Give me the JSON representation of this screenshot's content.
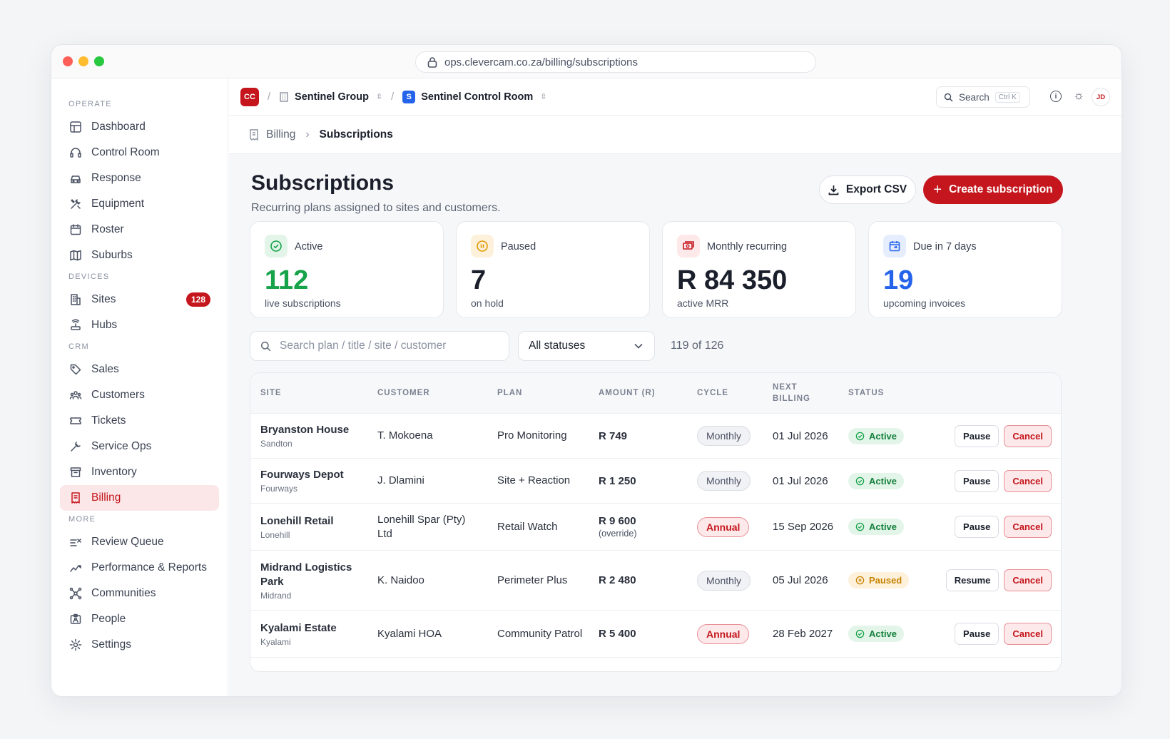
{
  "browser": {
    "url": "ops.clevercam.co.za/billing/subscriptions"
  },
  "sidebar": {
    "sections": [
      {
        "title": "OPERATE",
        "items": [
          {
            "label": "Dashboard",
            "icon": "layout-icon"
          },
          {
            "label": "Control Room",
            "icon": "headset-icon"
          },
          {
            "label": "Response",
            "icon": "car-icon"
          },
          {
            "label": "Equipment",
            "icon": "tools-icon"
          },
          {
            "label": "Roster",
            "icon": "calendar-icon"
          },
          {
            "label": "Suburbs",
            "icon": "map-icon"
          }
        ]
      },
      {
        "title": "DEVICES",
        "items": [
          {
            "label": "Sites",
            "icon": "building-icon",
            "badge": "128"
          },
          {
            "label": "Hubs",
            "icon": "router-icon"
          }
        ]
      },
      {
        "title": "CRM",
        "items": [
          {
            "label": "Sales",
            "icon": "tag-icon"
          },
          {
            "label": "Customers",
            "icon": "users-icon"
          },
          {
            "label": "Tickets",
            "icon": "ticket-icon"
          },
          {
            "label": "Service Ops",
            "icon": "wrench-icon"
          },
          {
            "label": "Inventory",
            "icon": "archive-icon"
          },
          {
            "label": "Billing",
            "icon": "receipt-icon",
            "active": true
          }
        ]
      },
      {
        "title": "MORE",
        "items": [
          {
            "label": "Review Queue",
            "icon": "review-icon"
          },
          {
            "label": "Performance & Reports",
            "icon": "chart-icon"
          },
          {
            "label": "Communities",
            "icon": "network-icon"
          },
          {
            "label": "People",
            "icon": "id-card-icon"
          },
          {
            "label": "Settings",
            "icon": "gear-icon"
          }
        ]
      }
    ]
  },
  "topbar": {
    "org_initials": "CC",
    "org": "Sentinel Group",
    "workspace_initial": "S",
    "workspace": "Sentinel Control Room",
    "search_label": "Search",
    "search_shortcut": "Ctrl K",
    "avatar": "JD"
  },
  "breadcrumb": {
    "parent": "Billing",
    "current": "Subscriptions"
  },
  "page": {
    "title": "Subscriptions",
    "subtitle": "Recurring plans assigned to sites and customers.",
    "export_label": "Export CSV",
    "create_label": "Create subscription"
  },
  "stats": [
    {
      "label": "Active",
      "value": "112",
      "sub": "live subscriptions",
      "color": "#16a34a",
      "icon": "check-circle-icon"
    },
    {
      "label": "Paused",
      "value": "7",
      "sub": "on hold",
      "color": "#1a1f2b",
      "icon": "pause-circle-icon"
    },
    {
      "label": "Monthly recurring",
      "value": "R 84 350",
      "sub": "active MRR",
      "color": "#1a1f2b",
      "icon": "money-icon"
    },
    {
      "label": "Due in 7 days",
      "value": "19",
      "sub": "upcoming invoices",
      "color": "#2563eb",
      "icon": "calendar-due-icon"
    }
  ],
  "filters": {
    "search_placeholder": "Search plan / title / site / customer",
    "status_value": "All statuses",
    "count": "119 of 126"
  },
  "table": {
    "columns": [
      "SITE",
      "CUSTOMER",
      "PLAN",
      "AMOUNT (R)",
      "CYCLE",
      "NEXT BILLING",
      "STATUS"
    ],
    "rows": [
      {
        "site": "Bryanston House",
        "suburb": "Sandton",
        "customer": "T. Mokoena",
        "plan": "Pro Monitoring",
        "amount": "R 749",
        "amount_note": "",
        "cycle": "Monthly",
        "next": "01 Jul 2026",
        "status": "Active",
        "action": "Pause",
        "cancel": "Cancel"
      },
      {
        "site": "Fourways Depot",
        "suburb": "Fourways",
        "customer": "J. Dlamini",
        "plan": "Site + Reaction",
        "amount": "R 1 250",
        "amount_note": "",
        "cycle": "Monthly",
        "next": "01 Jul 2026",
        "status": "Active",
        "action": "Pause",
        "cancel": "Cancel"
      },
      {
        "site": "Lonehill Retail",
        "suburb": "Lonehill",
        "customer": "Lonehill Spar (Pty) Ltd",
        "plan": "Retail Watch",
        "amount": "R 9 600",
        "amount_note": "(override)",
        "cycle": "Annual",
        "next": "15 Sep 2026",
        "status": "Active",
        "action": "Pause",
        "cancel": "Cancel"
      },
      {
        "site": "Midrand Logistics Park",
        "suburb": "Midrand",
        "customer": "K. Naidoo",
        "plan": "Perimeter Plus",
        "amount": "R 2 480",
        "amount_note": "",
        "cycle": "Monthly",
        "next": "05 Jul 2026",
        "status": "Paused",
        "action": "Resume",
        "cancel": "Cancel"
      },
      {
        "site": "Kyalami Estate",
        "suburb": "Kyalami",
        "customer": "Kyalami HOA",
        "plan": "Community Patrol",
        "amount": "R 5 400",
        "amount_note": "",
        "cycle": "Annual",
        "next": "28 Feb 2027",
        "status": "Active",
        "action": "Pause",
        "cancel": "Cancel"
      }
    ]
  },
  "colors": {
    "brand": "#c4161c",
    "active": "#16a34a",
    "paused": "#c98300",
    "accent_blue": "#2563eb"
  }
}
